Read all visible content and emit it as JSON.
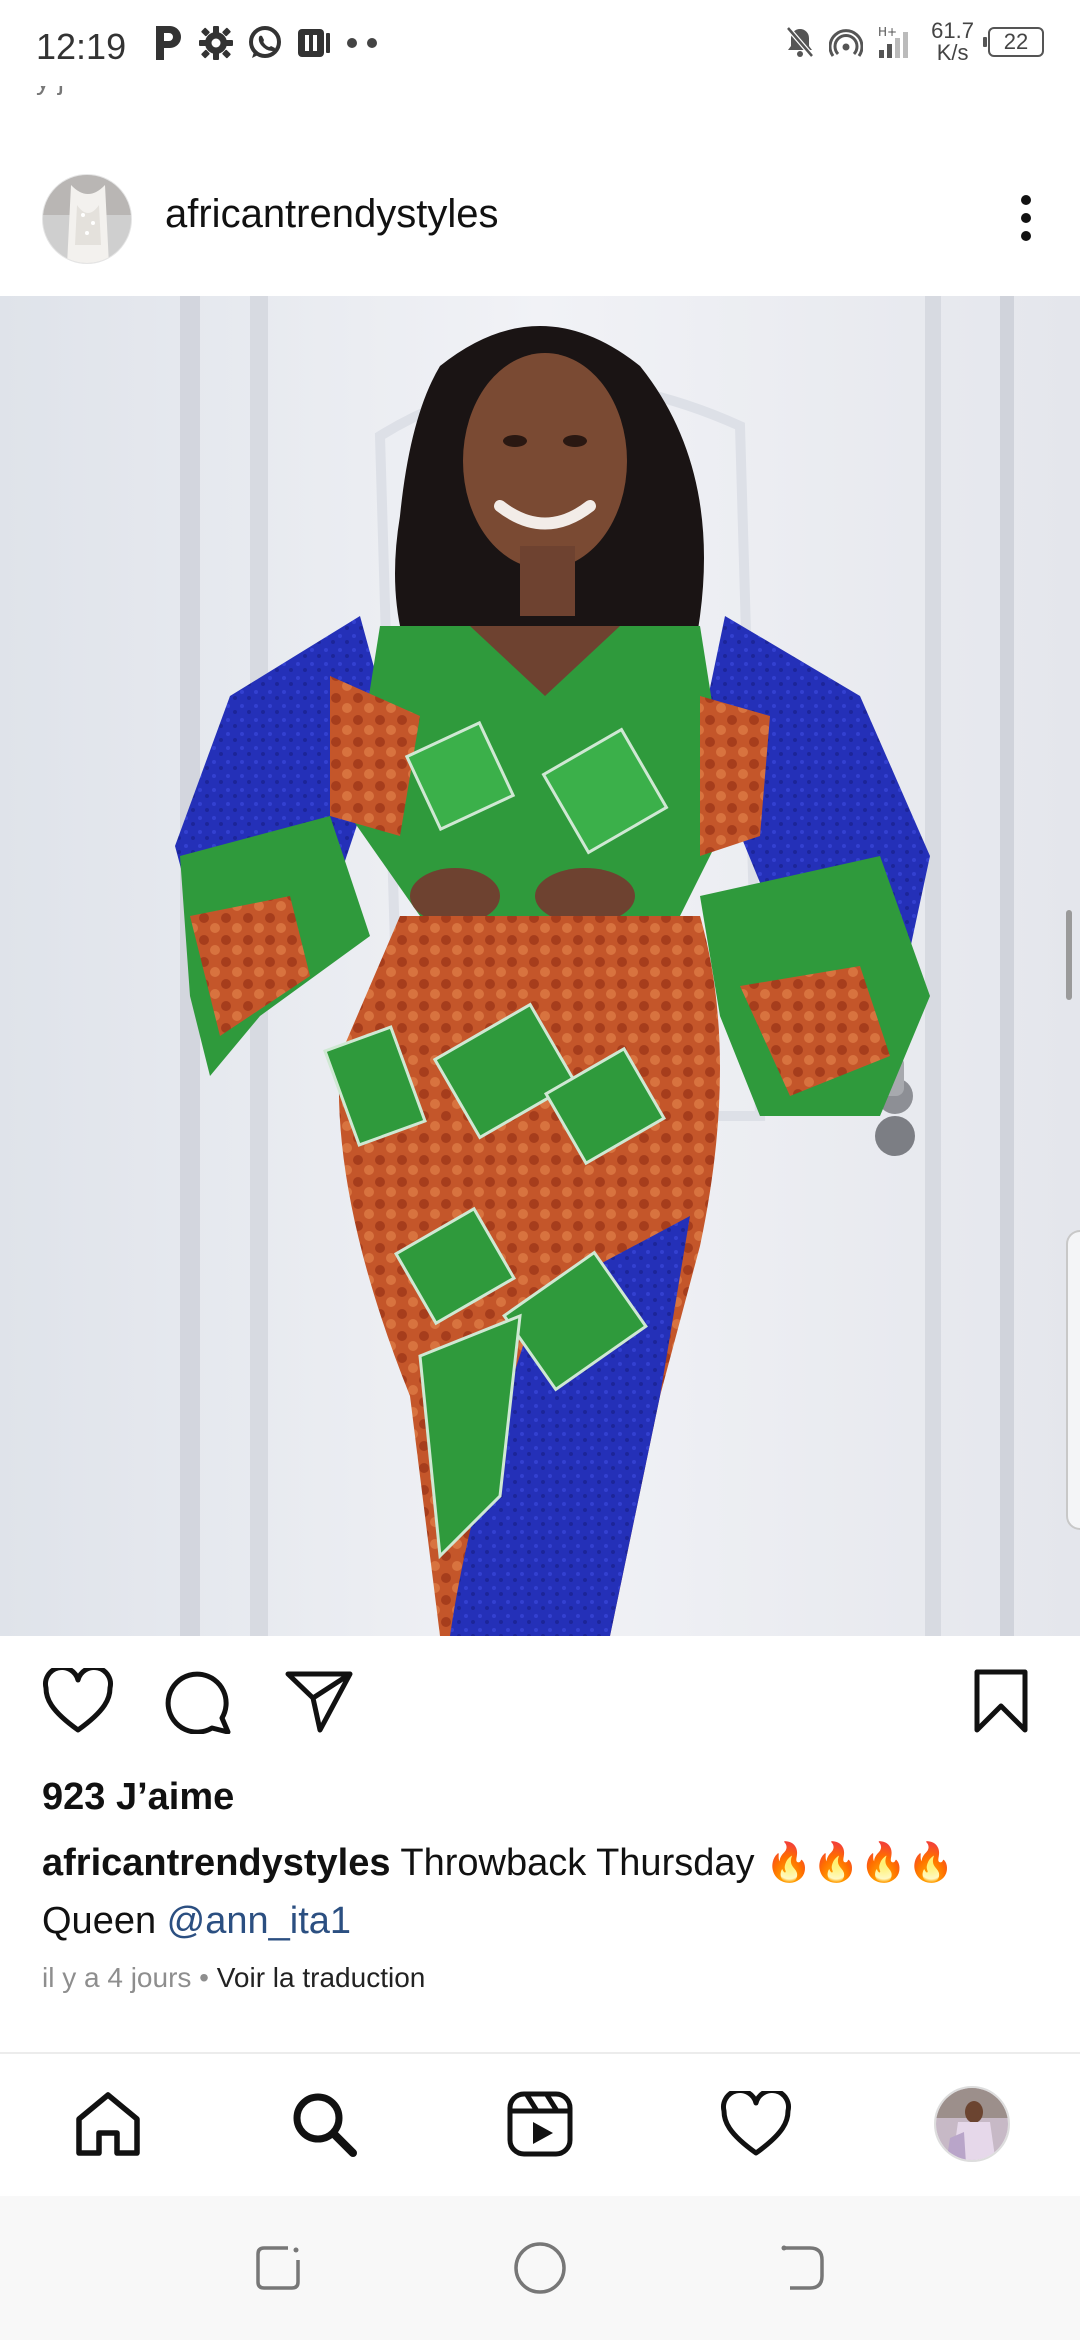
{
  "status_bar": {
    "time": "12:19",
    "left_icons": [
      "parking-icon",
      "gear-icon",
      "whatsapp-icon",
      "media-icon",
      "more-dots-icon"
    ],
    "right_icons": [
      "mute-bell-icon",
      "hotspot-icon",
      "signal-icon"
    ],
    "speed_value": "61.7",
    "speed_unit": "K/s",
    "battery": "22"
  },
  "post": {
    "username": "africantrendystyles",
    "likes": "923 J’aime",
    "caption_user": "africantrendystyles",
    "caption_text": " Throwback Thursday 🔥🔥🔥🔥",
    "caption_line2_prefix": "Queen ",
    "mention": "@ann_ita1",
    "time_ago": "il y a 4 jours",
    "separator": " • ",
    "translate_link": "Voir la traduction"
  },
  "actions": {
    "icons": [
      "heart-icon",
      "comment-icon",
      "share-icon",
      "bookmark-icon"
    ]
  },
  "bottom_nav": {
    "items": [
      "home-icon",
      "search-icon",
      "reels-icon",
      "activity-heart-icon",
      "profile-avatar"
    ]
  },
  "system_nav": {
    "buttons": [
      "recents-button",
      "home-button",
      "back-button"
    ]
  },
  "colors": {
    "mention": "#2b4f81",
    "meta_grey": "#8e8e8e",
    "dress_green": "#2f9a3c",
    "dress_red": "#c4562a",
    "dress_blue": "#2430b8"
  }
}
